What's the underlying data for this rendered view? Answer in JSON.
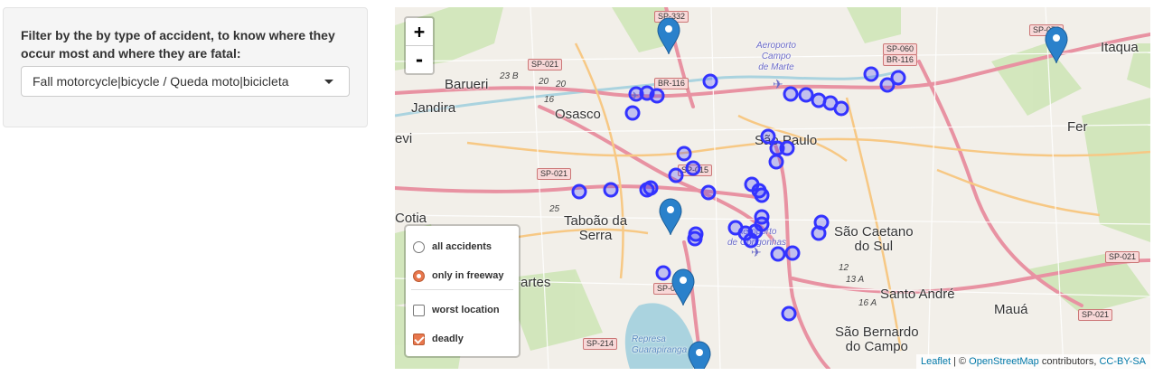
{
  "filter": {
    "label": "Filter by the by type of accident, to know where they occur most and where they are fatal:",
    "selected": "Fall motorcycle|bicycle / Queda moto|bicicleta"
  },
  "map": {
    "zoom_in": "+",
    "zoom_out": "-",
    "places": {
      "barueri": "Barueri",
      "jandira": "Jandira",
      "osasco": "Osasco",
      "sao_paulo": "São Paulo",
      "taboao": "Taboão da\nSerra",
      "cotia": "Cotia",
      "evi": "evi",
      "sao_caetano": "São Caetano\ndo Sul",
      "santo_andre": "Santo André",
      "maua": "Mauá",
      "sao_bernardo": "São Bernardo\ndo Campo",
      "itaqua": "Itaqua",
      "fer": "Fer",
      "artes": "artes",
      "aeroporto_marte": "Aeroporto\nCampo\nde Marte",
      "aeroporto_congonhas": "Aeroporto\nde Congonhas",
      "represa": "Represa\nGuarapiranga"
    },
    "roads": {
      "sp332": "SP-332",
      "sp021a": "SP-021",
      "sp021b": "SP-021",
      "sp021c": "SP-021",
      "sp021d": "SP-021",
      "sp021e": "SP-021",
      "br116a": "BR-116",
      "sp060": "SP-060",
      "br116b": "BR-116",
      "sp070": "SP-070",
      "sp015": "SP-015",
      "sp214": "SP-214",
      "sp0": "SP-0",
      "r23b": "23 B",
      "r20": "20",
      "r16a": "16",
      "r20b": "20",
      "r25": "25",
      "r12": "12",
      "r13a": "13 A",
      "r16b": "16 A"
    },
    "layers": {
      "all_accidents": "all accidents",
      "only_freeway": "only in freeway",
      "worst_location": "worst location",
      "deadly": "deadly",
      "selected_base": "only_freeway",
      "worst_location_checked": false,
      "deadly_checked": true
    },
    "attribution": {
      "leaflet": "Leaflet",
      "sep": " | © ",
      "osm": "OpenStreetMap",
      "contributors": " contributors, ",
      "license": "CC-BY-SA"
    },
    "colors": {
      "marker_circle": "#3333ff",
      "pin": "#2a81cb",
      "accent": "#e8774d"
    },
    "points": [
      {
        "name": "circle-1"
      },
      {
        "name": "circle-2"
      },
      {
        "name": "circle-3"
      },
      {
        "name": "circle-4"
      }
    ]
  }
}
